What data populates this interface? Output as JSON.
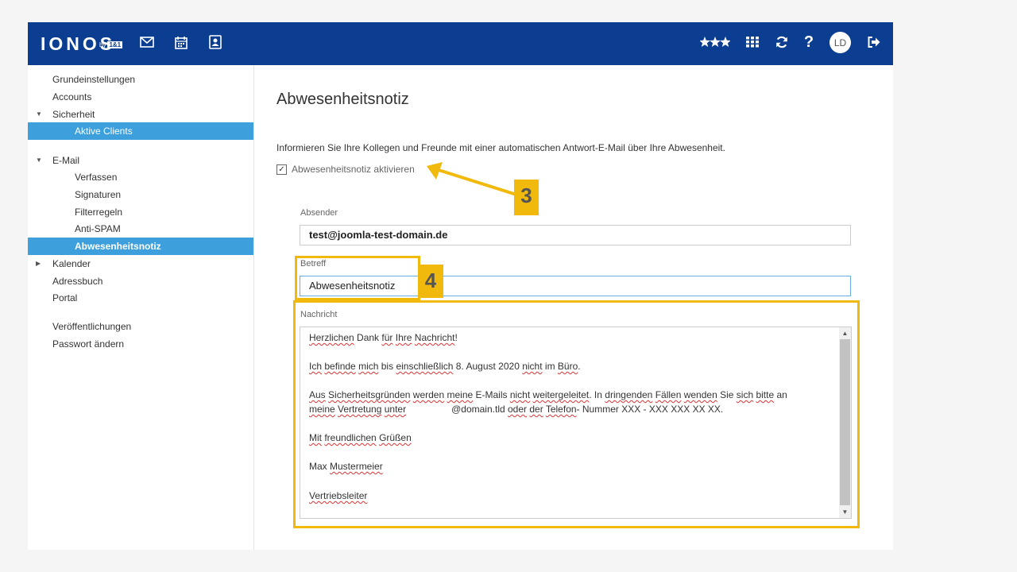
{
  "brand": {
    "logo": "IONOS",
    "logo_by": "by",
    "logo_box": "1&1"
  },
  "topbar": {
    "icons": [
      "mail-icon",
      "calendar-icon",
      "contacts-icon",
      "stars-icon",
      "apps-grid-icon",
      "refresh-icon",
      "help-icon",
      "logout-icon"
    ],
    "help_label": "?",
    "avatar_initials": "LD"
  },
  "sidebar": {
    "items": [
      {
        "label": "Grundeinstellungen"
      },
      {
        "label": "Accounts"
      },
      {
        "label": "Sicherheit",
        "expanded": true
      },
      {
        "label": "Aktive Clients",
        "selected": true
      },
      {
        "label": "E-Mail",
        "expanded": true
      },
      {
        "label": "Verfassen"
      },
      {
        "label": "Signaturen"
      },
      {
        "label": "Filterregeln"
      },
      {
        "label": "Anti-SPAM"
      },
      {
        "label": "Abwesenheitsnotiz",
        "selected": true
      },
      {
        "label": "Kalender",
        "expanded": false
      },
      {
        "label": "Adressbuch"
      },
      {
        "label": "Portal"
      },
      {
        "label": "Veröffentlichungen"
      },
      {
        "label": "Passwort ändern"
      }
    ]
  },
  "main": {
    "title": "Abwesenheitsnotiz",
    "intro": "Informieren Sie Ihre Kollegen und Freunde mit einer automatischen Antwort-E-Mail über Ihre Abwesenheit.",
    "activate_checkbox": {
      "label": "Abwesenheitsnotiz aktivieren",
      "checked": true,
      "mark": "✓"
    },
    "sender": {
      "label": "Absender",
      "value": "test@joomla-test-domain.de"
    },
    "subject": {
      "label": "Betreff",
      "value": "Abwesenheitsnotiz"
    },
    "message": {
      "label": "Nachricht",
      "line1": {
        "a": "Herzlichen",
        "b": " Dank ",
        "c": "für",
        "d": " ",
        "e": "Ihre",
        "f": " ",
        "g": "Nachricht",
        "h": "!"
      },
      "line2": {
        "a": "Ich",
        "b": " ",
        "c": "befinde",
        "d": " ",
        "e": "mich",
        "f": " bis ",
        "g": "einschließlich",
        "h": " 8. August 2020 ",
        "i": "nicht",
        "j": " im ",
        "k": "Büro",
        "l": "."
      },
      "line3": {
        "a": "Aus",
        "b": " ",
        "c": "Sicherheitsgründen",
        "d": " ",
        "e": "werden",
        "f": " ",
        "g": "meine",
        "h": " E-Mails ",
        "i": "nicht",
        "j": " ",
        "k": "weitergeleitet",
        "l": ". In ",
        "m": "dringenden",
        "n": " ",
        "o": "Fällen",
        "p": " ",
        "q": "wenden",
        "r": " Sie ",
        "s": "sich",
        "t": " ",
        "u": "bitte",
        "v": " an"
      },
      "line4": {
        "a": "meine",
        "b": " ",
        "c": "Vertretung",
        "d": " ",
        "e": "unter",
        "f": "@domain.tld ",
        "g": "oder",
        "h": " ",
        "i": "der",
        "j": " ",
        "k": "Telefon",
        "l": "- Nummer XXX - XXX XXX XX XX."
      },
      "line5": {
        "a": "Mit",
        "b": " ",
        "c": "freundlichen",
        "d": " ",
        "e": "Grüßen"
      },
      "line6": {
        "a": "Max",
        "b": " ",
        "c": "Mustermeier"
      },
      "line7": {
        "a": "Vertriebsleiter"
      },
      "scroll_up": "▲",
      "scroll_down": "▼"
    }
  },
  "annotations": {
    "step3": "3",
    "step4": "4",
    "highlight_color": "#f0b90b"
  }
}
